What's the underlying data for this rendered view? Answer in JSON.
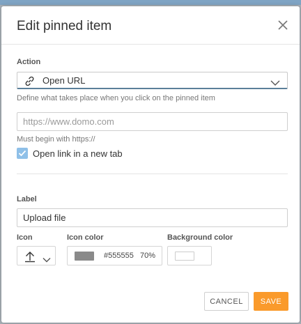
{
  "dialog": {
    "title": "Edit pinned item"
  },
  "action": {
    "label": "Action",
    "selected": "Open URL",
    "help": "Define what takes place when you click on the pinned item"
  },
  "url": {
    "value": "",
    "placeholder": "https://www.domo.com",
    "help": "Must begin with https://"
  },
  "new_tab": {
    "label": "Open link in a new tab",
    "checked": true
  },
  "label_field": {
    "label": "Label",
    "value": "Upload file"
  },
  "icon": {
    "label": "Icon",
    "name": "upload-icon"
  },
  "icon_color": {
    "label": "Icon color",
    "hex": "#555555",
    "opacity": "70%",
    "swatch_color": "#8a8a8a"
  },
  "background_color": {
    "label": "Background color",
    "swatch_color": "#ffffff"
  },
  "buttons": {
    "cancel": "CANCEL",
    "save": "SAVE"
  },
  "colors": {
    "accent": "#fa9a2b",
    "checkbox": "#8fc0e8",
    "select_underline": "#5a7f99"
  }
}
